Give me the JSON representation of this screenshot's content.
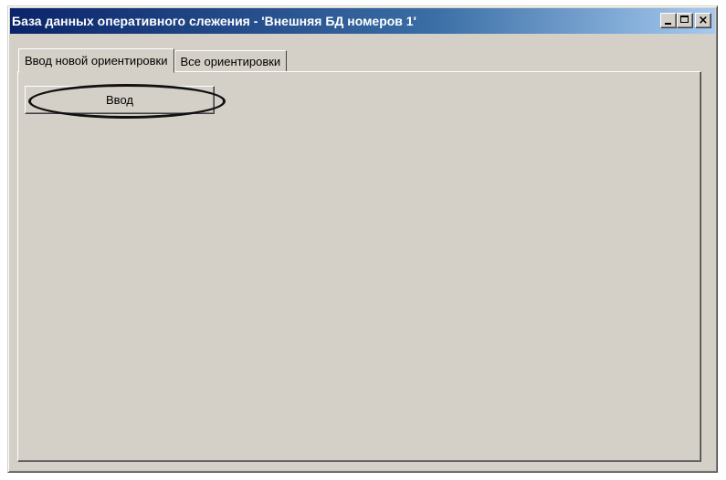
{
  "window": {
    "title": "База данных оперативного слежения - 'Внешняя БД номеров 1'",
    "controls": {
      "minimize_icon": "minimize-icon",
      "maximize_icon": "maximize-icon",
      "close_icon": "close-icon",
      "close_glyph": "×"
    }
  },
  "tabs": [
    {
      "label": "Ввод новой ориентировки",
      "active": true
    },
    {
      "label": "Все ориентировки",
      "active": false
    }
  ],
  "panel": {
    "enter_button_label": "Ввод"
  },
  "colors": {
    "face": "#d4d0c8",
    "title_start": "#0a246a",
    "title_end": "#a6caf0",
    "annotation": "#111111"
  }
}
